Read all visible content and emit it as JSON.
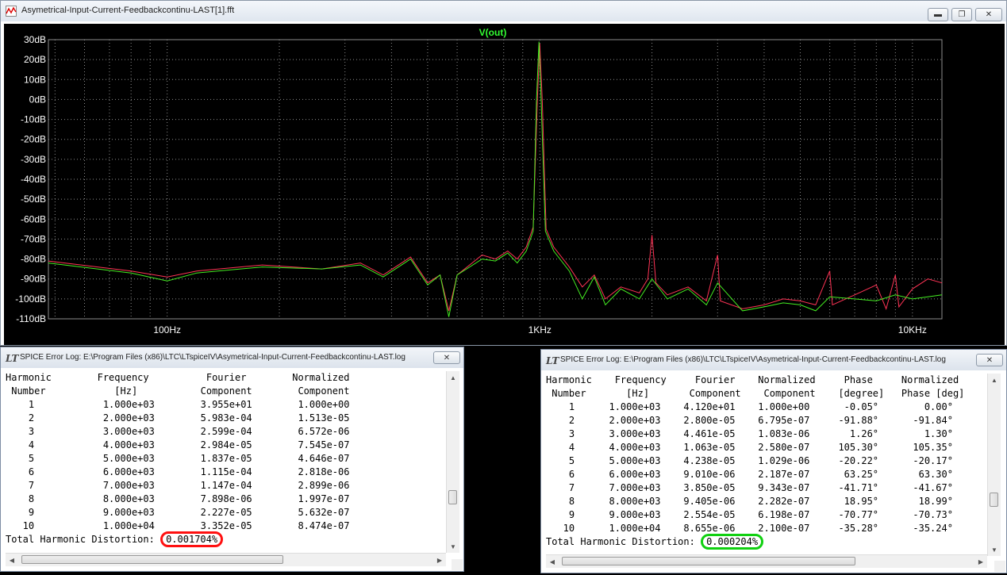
{
  "fft_window": {
    "title": "Asymetrical-Input-Current-Feedbackcontinu-LAST[1].fft",
    "icon": "waveform-icon",
    "buttons": {
      "minimize": "minimize-icon",
      "restore": "restore-icon",
      "close": "close-icon"
    }
  },
  "chart_data": {
    "type": "line",
    "title": "V(out)",
    "xscale": "log",
    "xlim": [
      48,
      12000
    ],
    "ylim": [
      -110,
      30
    ],
    "grid": true,
    "x_ticks": [
      "100Hz",
      "1KHz",
      "10KHz"
    ],
    "y_ticks": [
      "30dB",
      "20dB",
      "10dB",
      "0dB",
      "-10dB",
      "-20dB",
      "-30dB",
      "-40dB",
      "-50dB",
      "-60dB",
      "-70dB",
      "-80dB",
      "-90dB",
      "-100dB",
      "-110dB"
    ],
    "colors": {
      "title": "#33ff33",
      "grid": "#8c8c8c",
      "axis_text": "#ffffff",
      "series_red": "#ff3355",
      "series_green": "#44ee22"
    },
    "series": [
      {
        "color": "#ff3355",
        "points": [
          [
            48,
            -81
          ],
          [
            80,
            -86
          ],
          [
            100,
            -89
          ],
          [
            120,
            -86
          ],
          [
            180,
            -83
          ],
          [
            260,
            -85
          ],
          [
            330,
            -82
          ],
          [
            380,
            -88
          ],
          [
            450,
            -79
          ],
          [
            500,
            -92
          ],
          [
            540,
            -88
          ],
          [
            570,
            -106
          ],
          [
            600,
            -88
          ],
          [
            700,
            -78
          ],
          [
            760,
            -80
          ],
          [
            820,
            -76
          ],
          [
            870,
            -80
          ],
          [
            920,
            -74
          ],
          [
            960,
            -64
          ],
          [
            985,
            0
          ],
          [
            1000,
            28
          ],
          [
            1015,
            0
          ],
          [
            1040,
            -65
          ],
          [
            1090,
            -74
          ],
          [
            1200,
            -84
          ],
          [
            1300,
            -94
          ],
          [
            1400,
            -88
          ],
          [
            1500,
            -100
          ],
          [
            1650,
            -94
          ],
          [
            1850,
            -97
          ],
          [
            1950,
            -90
          ],
          [
            2000,
            -68
          ],
          [
            2050,
            -92
          ],
          [
            2200,
            -98
          ],
          [
            2500,
            -94
          ],
          [
            2800,
            -101
          ],
          [
            3000,
            -78
          ],
          [
            3050,
            -101
          ],
          [
            3500,
            -105
          ],
          [
            4000,
            -103
          ],
          [
            4500,
            -100
          ],
          [
            5000,
            -101
          ],
          [
            5500,
            -103
          ],
          [
            6000,
            -86
          ],
          [
            6100,
            -103
          ],
          [
            7000,
            -98
          ],
          [
            8000,
            -93
          ],
          [
            8500,
            -105
          ],
          [
            9000,
            -88
          ],
          [
            9200,
            -104
          ],
          [
            10000,
            -95
          ],
          [
            11000,
            -90
          ],
          [
            12000,
            -92
          ]
        ]
      },
      {
        "color": "#44ee22",
        "points": [
          [
            48,
            -82
          ],
          [
            80,
            -87
          ],
          [
            100,
            -91
          ],
          [
            120,
            -87
          ],
          [
            180,
            -84
          ],
          [
            260,
            -85
          ],
          [
            330,
            -83
          ],
          [
            380,
            -89
          ],
          [
            450,
            -80
          ],
          [
            500,
            -93
          ],
          [
            540,
            -88
          ],
          [
            570,
            -109
          ],
          [
            600,
            -88
          ],
          [
            700,
            -80
          ],
          [
            760,
            -81
          ],
          [
            820,
            -77
          ],
          [
            870,
            -82
          ],
          [
            920,
            -76
          ],
          [
            960,
            -66
          ],
          [
            980,
            0
          ],
          [
            995,
            29
          ],
          [
            1008,
            0
          ],
          [
            1035,
            -66
          ],
          [
            1090,
            -76
          ],
          [
            1200,
            -86
          ],
          [
            1300,
            -100
          ],
          [
            1400,
            -89
          ],
          [
            1500,
            -103
          ],
          [
            1650,
            -95
          ],
          [
            1850,
            -100
          ],
          [
            2000,
            -90
          ],
          [
            2200,
            -100
          ],
          [
            2500,
            -95
          ],
          [
            2800,
            -103
          ],
          [
            3000,
            -92
          ],
          [
            3500,
            -106
          ],
          [
            4000,
            -104
          ],
          [
            4500,
            -102
          ],
          [
            5000,
            -103
          ],
          [
            5500,
            -106
          ],
          [
            6000,
            -99
          ],
          [
            7000,
            -100
          ],
          [
            8000,
            -101
          ],
          [
            9000,
            -98
          ],
          [
            10000,
            -100
          ],
          [
            11000,
            -99
          ],
          [
            12000,
            -98
          ]
        ]
      }
    ]
  },
  "log1": {
    "title": "SPICE Error Log: E:\\Program Files (x86)\\LTC\\LTspiceIV\\Asymetrical-Input-Current-Feedbackcontinu-LAST.log",
    "close_icon": "close-icon",
    "table_text": "Harmonic        Frequency          Fourier        Normalized\n Number            [Hz]           Component        Component\n    1            1.000e+03        3.955e+01        1.000e+00\n    2            2.000e+03        5.983e-04        1.513e-05\n    3            3.000e+03        2.599e-04        6.572e-06\n    4            4.000e+03        2.984e-05        7.545e-07\n    5            5.000e+03        1.837e-05        4.646e-07\n    6            6.000e+03        1.115e-04        2.818e-06\n    7            7.000e+03        1.147e-04        2.899e-06\n    8            8.000e+03        7.898e-06        1.997e-07\n    9            9.000e+03        2.227e-05        5.632e-07\n   10            1.000e+04        3.352e-05        8.474e-07",
    "thd_label": "Total Harmonic Distortion: ",
    "thd_value": "0.001704%",
    "thd_highlight": "#ff1010"
  },
  "log2": {
    "title": "SPICE Error Log: E:\\Program Files (x86)\\LTC\\LTspiceIV\\Asymetrical-Input-Current-Feedbackcontinu-LAST.log",
    "close_icon": "close-icon",
    "table_text": "Harmonic    Frequency     Fourier    Normalized     Phase     Normalized\n Number       [Hz]       Component    Component    [degree]   Phase [deg]\n    1      1.000e+03    4.120e+01    1.000e+00      -0.05°        0.00°\n    2      2.000e+03    2.800e-05    6.795e-07     -91.88°      -91.84°\n    3      3.000e+03    4.461e-05    1.083e-06       1.26°        1.30°\n    4      4.000e+03    1.063e-05    2.580e-07     105.30°      105.35°\n    5      5.000e+03    4.238e-05    1.029e-06     -20.22°      -20.17°\n    6      6.000e+03    9.010e-06    2.187e-07      63.25°       63.30°\n    7      7.000e+03    3.850e-05    9.343e-07     -41.71°      -41.67°\n    8      8.000e+03    9.405e-06    2.282e-07      18.95°       18.99°\n    9      9.000e+03    2.554e-05    6.198e-07     -70.77°      -70.73°\n   10      1.000e+04    8.655e-06    2.100e-07     -35.28°      -35.24°",
    "thd_label": "Total Harmonic Distortion: ",
    "thd_value": "0.000204%",
    "thd_highlight": "#10d010"
  }
}
